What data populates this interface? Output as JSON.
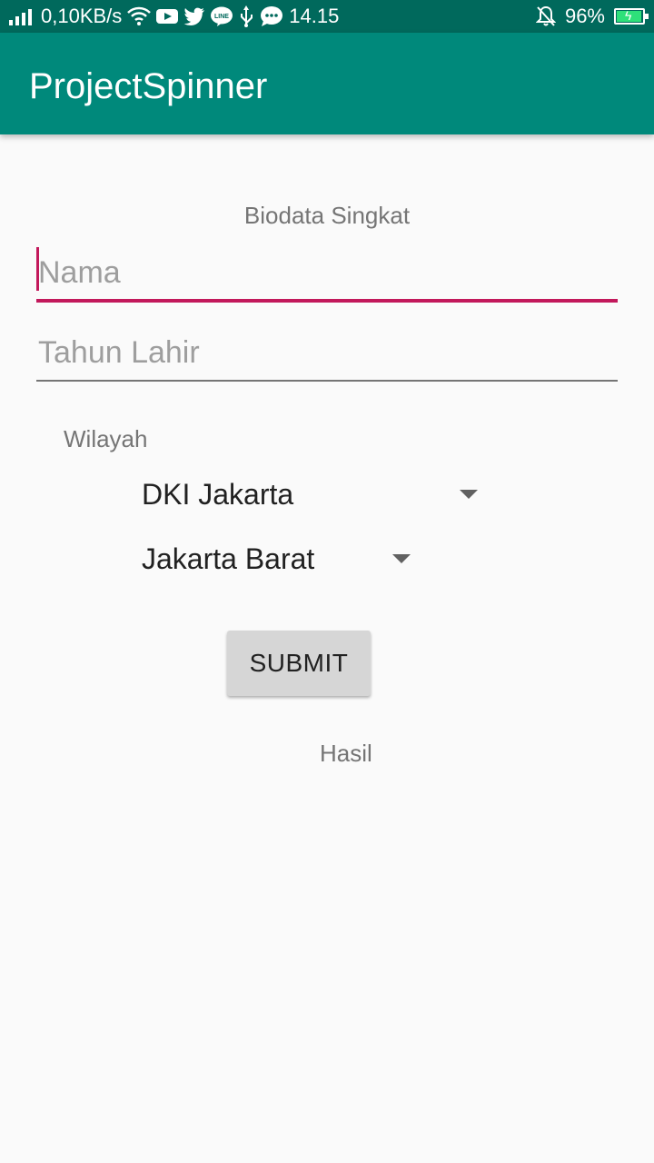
{
  "status_bar": {
    "net_speed": "0,10KB/s",
    "time": "14.15",
    "battery": "96%",
    "battery_level": 0.96,
    "icons": [
      "signal-icon",
      "wifi-icon",
      "youtube-icon",
      "twitter-icon",
      "line-icon",
      "usb-icon",
      "message-icon",
      "silent-bell-icon",
      "battery-icon"
    ]
  },
  "appbar": {
    "title": "ProjectSpinner"
  },
  "form": {
    "heading": "Biodata Singkat",
    "name_placeholder": "Nama",
    "year_placeholder": "Tahun Lahir",
    "region_label": "Wilayah",
    "province_value": "DKI Jakarta",
    "city_value": "Jakarta Barat",
    "submit_label": "SUBMIT",
    "result_label": "Hasil"
  },
  "colors": {
    "status_bar": "#00695c",
    "app_bar": "#00897b",
    "accent": "#c2185b",
    "background": "#fafafa"
  }
}
